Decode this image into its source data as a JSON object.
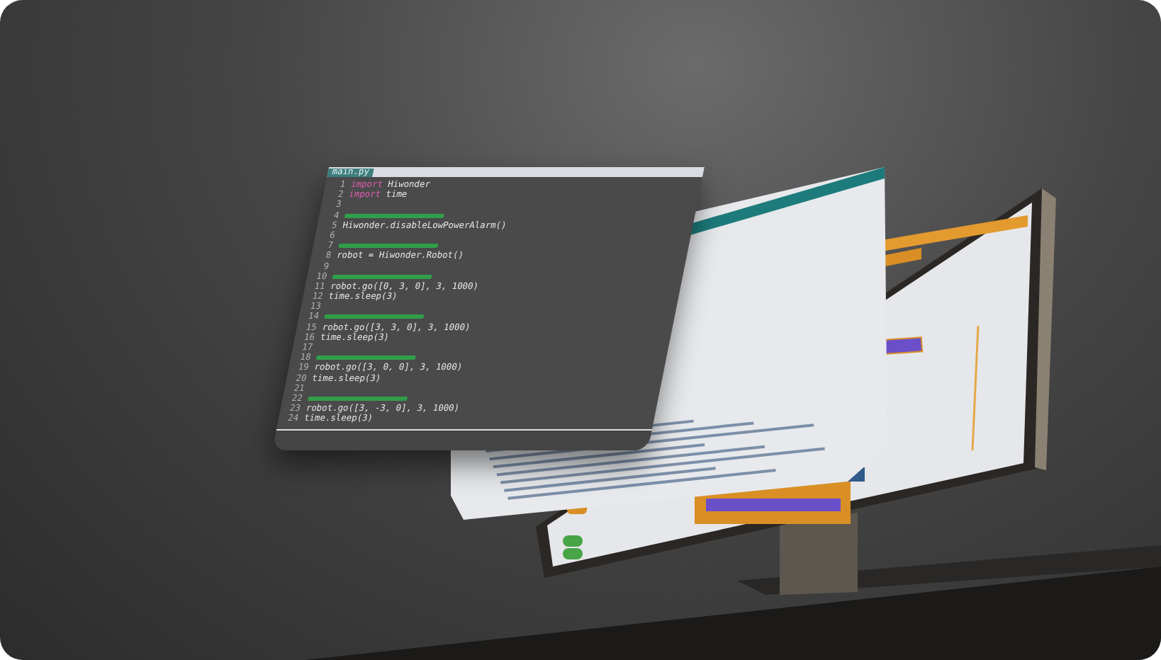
{
  "code_panel": {
    "tab": "main.py",
    "lines": [
      {
        "kind": "code",
        "number": "1",
        "keyword": "import",
        "text": " Hiwonder"
      },
      {
        "kind": "code",
        "number": "2",
        "keyword": "import",
        "text": " time"
      },
      {
        "kind": "blank",
        "number": "3"
      },
      {
        "kind": "comment",
        "number": "4"
      },
      {
        "kind": "code",
        "number": "5",
        "text": "Hiwonder.disableLowPowerAlarm()"
      },
      {
        "kind": "blank",
        "number": "6"
      },
      {
        "kind": "comment",
        "number": "7"
      },
      {
        "kind": "code",
        "number": "8",
        "text": "robot = Hiwonder.Robot()"
      },
      {
        "kind": "blank",
        "number": "9"
      },
      {
        "kind": "comment",
        "number": "10"
      },
      {
        "kind": "code",
        "number": "11",
        "text": "robot.go([0, 3, 0], 3, 1000)"
      },
      {
        "kind": "code",
        "number": "12",
        "text": "time.sleep(3)"
      },
      {
        "kind": "blank",
        "number": "13"
      },
      {
        "kind": "comment",
        "number": "14"
      },
      {
        "kind": "code",
        "number": "15",
        "text": "robot.go([3, 3, 0], 3, 1000)"
      },
      {
        "kind": "code",
        "number": "16",
        "text": "time.sleep(3)"
      },
      {
        "kind": "blank",
        "number": "17"
      },
      {
        "kind": "comment",
        "number": "18"
      },
      {
        "kind": "code",
        "number": "19",
        "text": "robot.go([3, 0, 0], 3, 1000)"
      },
      {
        "kind": "code",
        "number": "20",
        "text": "time.sleep(3)"
      },
      {
        "kind": "blank",
        "number": "21"
      },
      {
        "kind": "comment",
        "number": "22"
      },
      {
        "kind": "code",
        "number": "23",
        "text": "robot.go([3, -3, 0], 3, 1000)"
      },
      {
        "kind": "code",
        "number": "24",
        "text": "time.sleep(3)"
      }
    ]
  }
}
